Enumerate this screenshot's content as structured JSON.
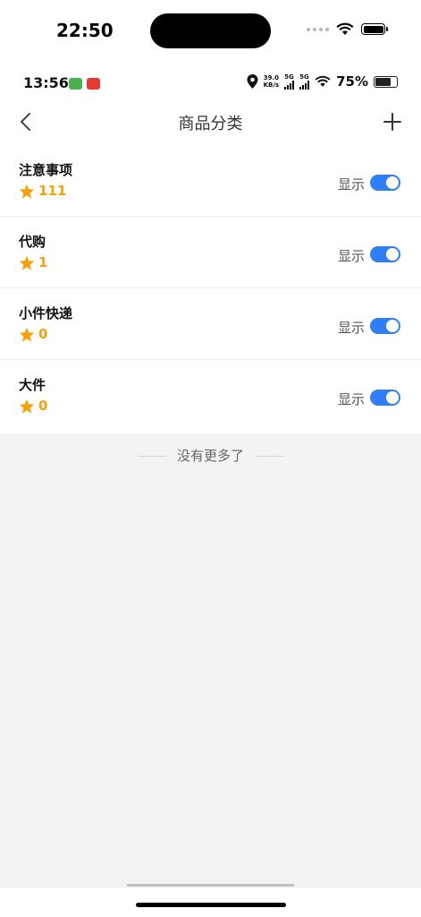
{
  "ios_status": {
    "time": "22:50"
  },
  "android_status": {
    "time": "13:56",
    "speed_top": "39.0",
    "speed_unit": "KB/s",
    "net1": "5G",
    "net2": "5G",
    "battery": "75%"
  },
  "header": {
    "title": "商品分类",
    "back_icon": "chevron-left-icon",
    "add_icon": "plus-icon"
  },
  "categories": [
    {
      "name": "注意事项",
      "count": "111",
      "visibility_label": "显示",
      "enabled": true
    },
    {
      "name": "代购",
      "count": "1",
      "visibility_label": "显示",
      "enabled": true
    },
    {
      "name": "小件快递",
      "count": "0",
      "visibility_label": "显示",
      "enabled": true
    },
    {
      "name": "大件",
      "count": "0",
      "visibility_label": "显示",
      "enabled": true
    }
  ],
  "footer": {
    "end_text": "没有更多了"
  },
  "colors": {
    "accent": "#2f7ef5",
    "star": "#f5a10a",
    "background": "#f2f3f5"
  }
}
